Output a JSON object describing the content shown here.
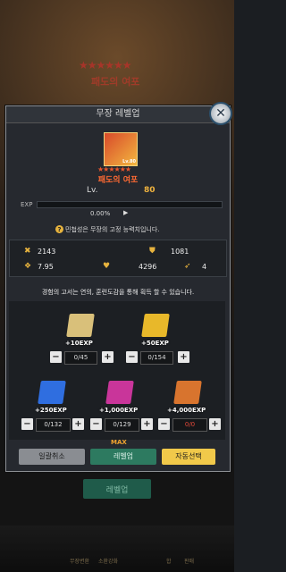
{
  "background": {
    "stars": "★★★★★★",
    "hero_name": "패도의 여포",
    "levelup_button": "레벨업",
    "bottom_tabs": [
      "무장변환",
      "소환강화",
      "",
      "합",
      "판매"
    ]
  },
  "dialog": {
    "title": "무장 레벨업",
    "close_icon": "✕",
    "hero": {
      "level_badge": "Lv.80",
      "stars": "★★★★★★",
      "name": "패도의 여포",
      "level_label": "Lv.",
      "level_value": "80",
      "exp_label": "EXP",
      "exp_percent": "0.00%",
      "exp_fill": 0.0
    },
    "info_text": "민첩성은 무장의 고정 능력치입니다.",
    "stats": {
      "attack": "2143",
      "defense": "1081",
      "agility": "7.95",
      "hp": "4296",
      "move": "4"
    },
    "description": "경험의 고서는 연의, 훈련도감을 통해 획득 할 수 있습니다.",
    "books": [
      {
        "exp_label": "+10EXP",
        "count": "0/45",
        "color": "#d9c07a"
      },
      {
        "exp_label": "+50EXP",
        "count": "0/154",
        "color": "#e8b82a"
      },
      {
        "exp_label": "+250EXP",
        "count": "0/132",
        "color": "#2f6ee0"
      },
      {
        "exp_label": "+1,000EXP",
        "count": "0/129",
        "color": "#c9359a"
      },
      {
        "exp_label": "+4,000EXP",
        "count": "0/0",
        "color": "#d8742e"
      }
    ],
    "minus": "−",
    "plus": "+",
    "buttons": {
      "cancel_all": "일괄취소",
      "max_label": "MAX",
      "levelup": "레벨업",
      "auto_select": "자동선택"
    }
  }
}
